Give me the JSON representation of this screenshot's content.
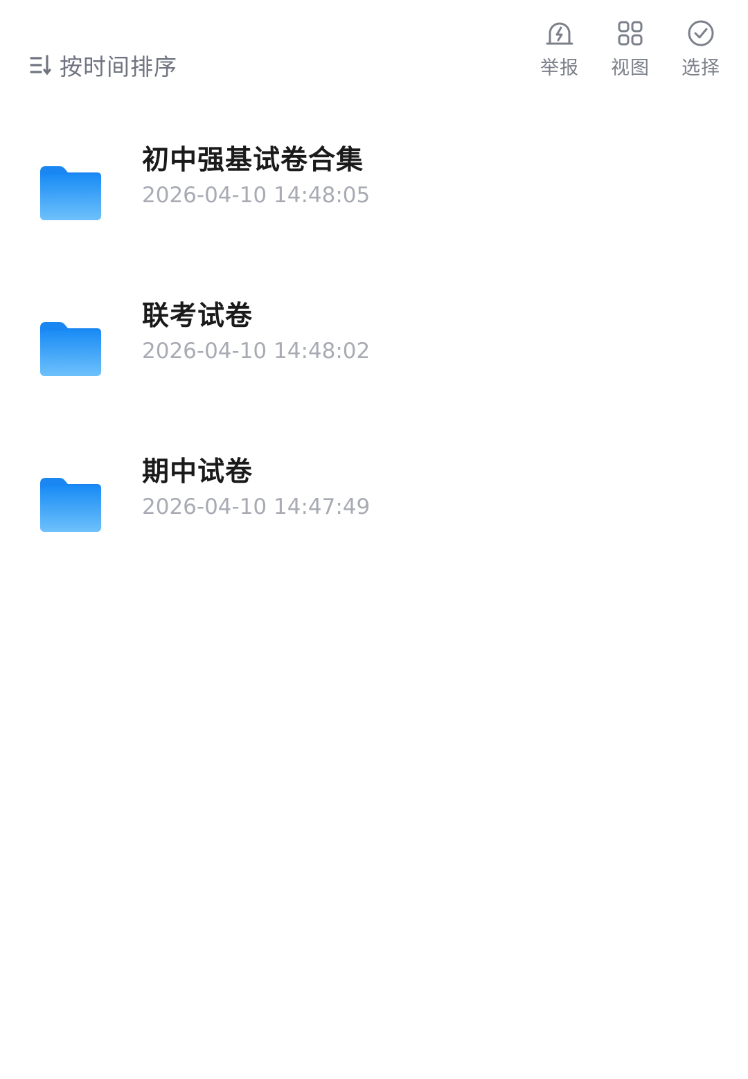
{
  "toolbar": {
    "sort_label": "按时间排序",
    "actions": [
      {
        "label": "举报",
        "icon": "report-icon"
      },
      {
        "label": "视图",
        "icon": "grid-view-icon"
      },
      {
        "label": "选择",
        "icon": "check-circle-icon"
      }
    ]
  },
  "files": [
    {
      "name": "初中强基试卷合集",
      "time": "2026-04-10 14:48:05",
      "icon": "folder-icon"
    },
    {
      "name": "联考试卷",
      "time": "2026-04-10 14:48:02",
      "icon": "folder-icon"
    },
    {
      "name": "期中试卷",
      "time": "2026-04-10 14:47:49",
      "icon": "folder-icon"
    }
  ],
  "colors": {
    "folder_top": "#1a8cf5",
    "folder_bottom": "#6ec1fb",
    "icon_gray": "#7b808a",
    "title": "#1a1a1a",
    "time": "#a8abb3"
  }
}
